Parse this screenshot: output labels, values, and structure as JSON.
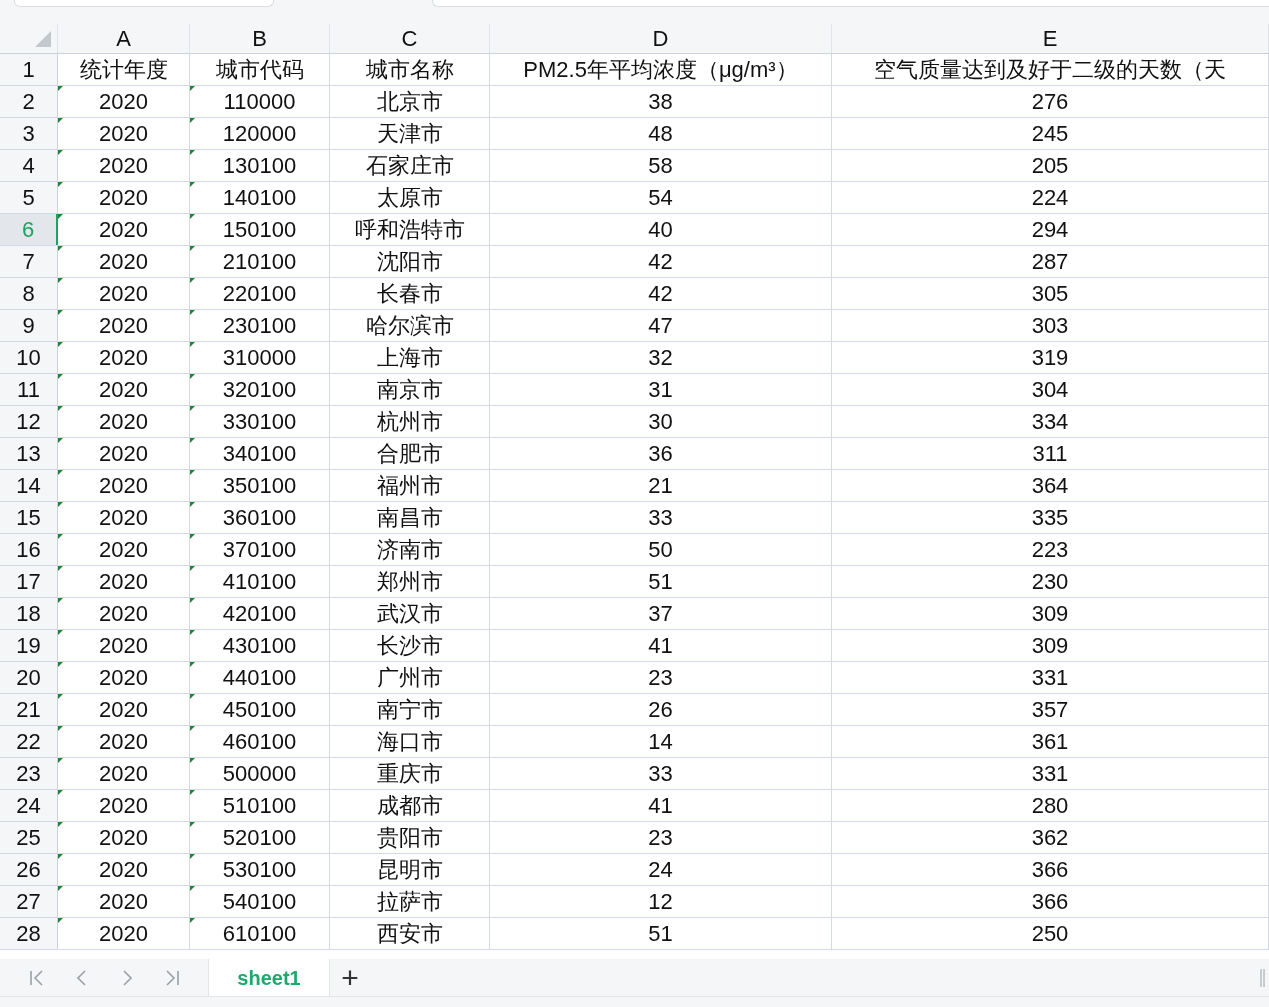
{
  "columns": [
    {
      "letter": "A",
      "text_marker": true
    },
    {
      "letter": "B",
      "text_marker": true
    },
    {
      "letter": "C",
      "text_marker": false
    },
    {
      "letter": "D",
      "text_marker": false
    },
    {
      "letter": "E",
      "text_marker": false
    }
  ],
  "rows": [
    {
      "number": "1",
      "selected": false,
      "cells": [
        "统计年度",
        "城市代码",
        "城市名称",
        "PM2.5年平均浓度（μg/m³）",
        "空气质量达到及好于二级的天数（天"
      ]
    },
    {
      "number": "2",
      "selected": false,
      "cells": [
        "2020",
        "110000",
        "北京市",
        "38",
        "276"
      ]
    },
    {
      "number": "3",
      "selected": false,
      "cells": [
        "2020",
        "120000",
        "天津市",
        "48",
        "245"
      ]
    },
    {
      "number": "4",
      "selected": false,
      "cells": [
        "2020",
        "130100",
        "石家庄市",
        "58",
        "205"
      ]
    },
    {
      "number": "5",
      "selected": false,
      "cells": [
        "2020",
        "140100",
        "太原市",
        "54",
        "224"
      ]
    },
    {
      "number": "6",
      "selected": true,
      "cells": [
        "2020",
        "150100",
        "呼和浩特市",
        "40",
        "294"
      ]
    },
    {
      "number": "7",
      "selected": false,
      "cells": [
        "2020",
        "210100",
        "沈阳市",
        "42",
        "287"
      ]
    },
    {
      "number": "8",
      "selected": false,
      "cells": [
        "2020",
        "220100",
        "长春市",
        "42",
        "305"
      ]
    },
    {
      "number": "9",
      "selected": false,
      "cells": [
        "2020",
        "230100",
        "哈尔滨市",
        "47",
        "303"
      ]
    },
    {
      "number": "10",
      "selected": false,
      "cells": [
        "2020",
        "310000",
        "上海市",
        "32",
        "319"
      ]
    },
    {
      "number": "11",
      "selected": false,
      "cells": [
        "2020",
        "320100",
        "南京市",
        "31",
        "304"
      ]
    },
    {
      "number": "12",
      "selected": false,
      "cells": [
        "2020",
        "330100",
        "杭州市",
        "30",
        "334"
      ]
    },
    {
      "number": "13",
      "selected": false,
      "cells": [
        "2020",
        "340100",
        "合肥市",
        "36",
        "311"
      ]
    },
    {
      "number": "14",
      "selected": false,
      "cells": [
        "2020",
        "350100",
        "福州市",
        "21",
        "364"
      ]
    },
    {
      "number": "15",
      "selected": false,
      "cells": [
        "2020",
        "360100",
        "南昌市",
        "33",
        "335"
      ]
    },
    {
      "number": "16",
      "selected": false,
      "cells": [
        "2020",
        "370100",
        "济南市",
        "50",
        "223"
      ]
    },
    {
      "number": "17",
      "selected": false,
      "cells": [
        "2020",
        "410100",
        "郑州市",
        "51",
        "230"
      ]
    },
    {
      "number": "18",
      "selected": false,
      "cells": [
        "2020",
        "420100",
        "武汉市",
        "37",
        "309"
      ]
    },
    {
      "number": "19",
      "selected": false,
      "cells": [
        "2020",
        "430100",
        "长沙市",
        "41",
        "309"
      ]
    },
    {
      "number": "20",
      "selected": false,
      "cells": [
        "2020",
        "440100",
        "广州市",
        "23",
        "331"
      ]
    },
    {
      "number": "21",
      "selected": false,
      "cells": [
        "2020",
        "450100",
        "南宁市",
        "26",
        "357"
      ]
    },
    {
      "number": "22",
      "selected": false,
      "cells": [
        "2020",
        "460100",
        "海口市",
        "14",
        "361"
      ]
    },
    {
      "number": "23",
      "selected": false,
      "cells": [
        "2020",
        "500000",
        "重庆市",
        "33",
        "331"
      ]
    },
    {
      "number": "24",
      "selected": false,
      "cells": [
        "2020",
        "510100",
        "成都市",
        "41",
        "280"
      ]
    },
    {
      "number": "25",
      "selected": false,
      "cells": [
        "2020",
        "520100",
        "贵阳市",
        "23",
        "362"
      ]
    },
    {
      "number": "26",
      "selected": false,
      "cells": [
        "2020",
        "530100",
        "昆明市",
        "24",
        "366"
      ]
    },
    {
      "number": "27",
      "selected": false,
      "cells": [
        "2020",
        "540100",
        "拉萨市",
        "12",
        "366"
      ]
    },
    {
      "number": "28",
      "selected": false,
      "cells": [
        "2020",
        "610100",
        "西安市",
        "51",
        "250"
      ]
    }
  ],
  "sheet_tabs": [
    {
      "label": "sheet1",
      "selected": true
    }
  ],
  "add_sheet": "+"
}
